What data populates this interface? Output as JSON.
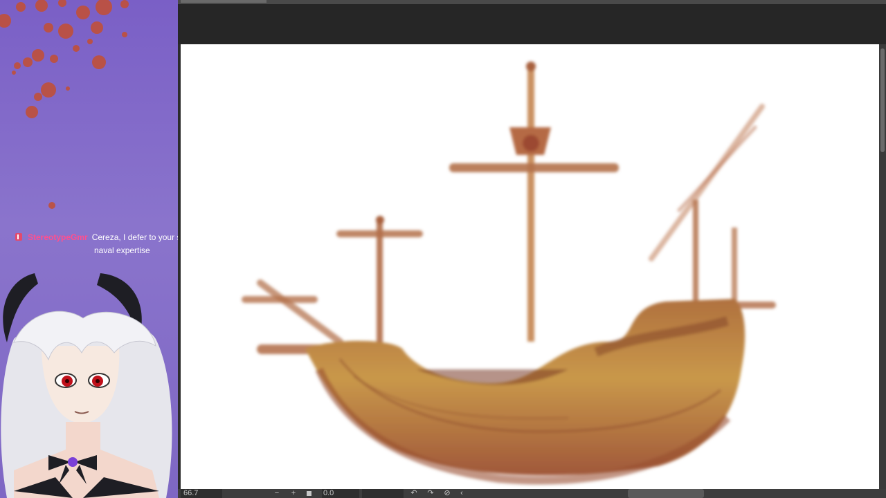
{
  "chat": {
    "username": "StereotypeGmr",
    "message_line1": "Cereza, I defer to your superior",
    "message_line2": "naval expertise"
  },
  "statusbar": {
    "zoom": "66.7",
    "zoom_out_icon": "−",
    "zoom_in_icon": "+",
    "angle": "0.0",
    "rotate_left_icon": "↶",
    "rotate_right_icon": "↷",
    "reset_rotation_icon": "⊘",
    "flip_icon": "‹"
  },
  "colors": {
    "overlay_purple": "#7a5fc6",
    "splatter": "#c0503a",
    "chat_username": "#ff4f8f",
    "app_dark": "#262626",
    "canvas": "#ffffff",
    "hull_brown": "#a0583a",
    "hull_gold": "#c8963c"
  },
  "icons": {
    "chat_badge": "moderator-badge-icon",
    "zoom_out": "minus-icon",
    "zoom_in": "plus-icon",
    "fit": "square-icon",
    "rotate_left": "rotate-left-icon",
    "rotate_right": "rotate-right-icon",
    "reset_rotation": "reset-rotation-icon",
    "flip": "chevron-left-icon"
  }
}
